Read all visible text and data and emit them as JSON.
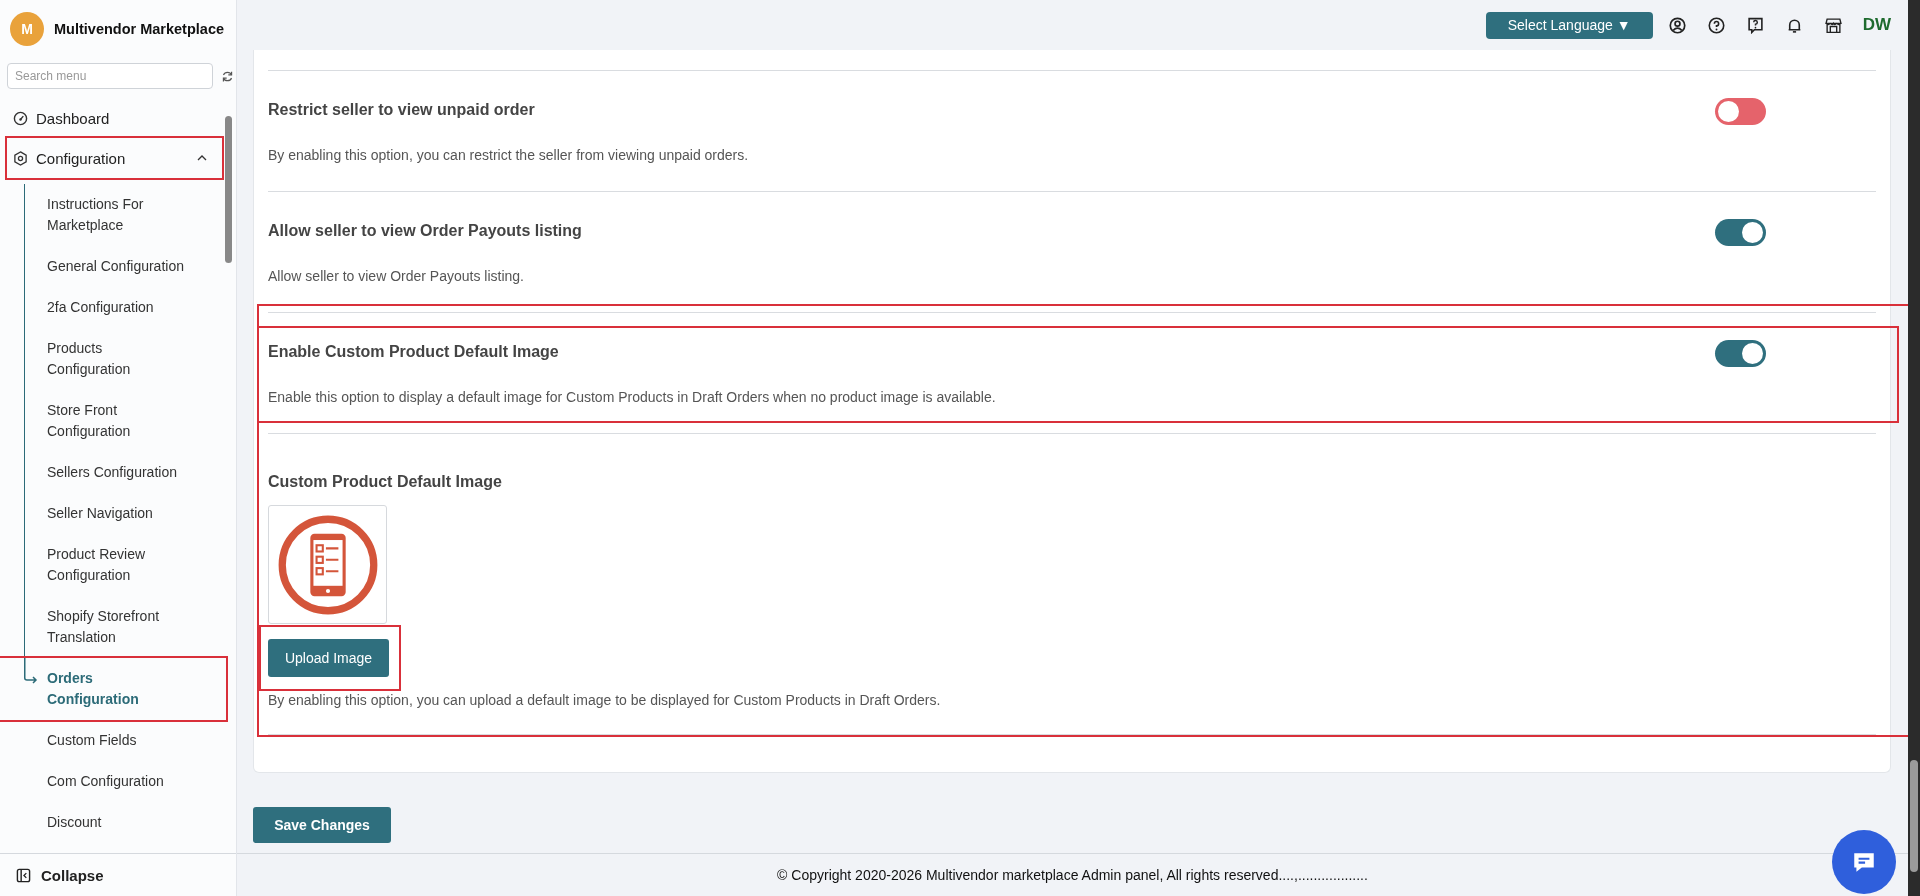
{
  "brand": {
    "initial": "M",
    "name": "Multivendor Marketplace"
  },
  "search": {
    "placeholder": "Search menu"
  },
  "nav": [
    {
      "kind": "item",
      "label": "Dashboard"
    },
    {
      "kind": "group",
      "label": "Configuration",
      "expanded": true,
      "annotated": true,
      "children": [
        {
          "label": "Instructions For Marketplace",
          "selected": false
        },
        {
          "label": "General Configuration",
          "selected": false
        },
        {
          "label": "2fa Configuration",
          "selected": false
        },
        {
          "label": "Products Configuration",
          "selected": false
        },
        {
          "label": "Store Front Configuration",
          "selected": false
        },
        {
          "label": "Sellers Configuration",
          "selected": false
        },
        {
          "label": "Seller Navigation",
          "selected": false
        },
        {
          "label": "Product Review Configuration",
          "selected": false
        },
        {
          "label": "Shopify Storefront Translation",
          "selected": false
        },
        {
          "label": "Orders Configuration",
          "selected": true,
          "annotated": true
        },
        {
          "label": "Custom Fields",
          "selected": false
        },
        {
          "label": "Com Configuration",
          "selected": false
        },
        {
          "label": "Discount",
          "selected": false
        }
      ]
    }
  ],
  "collapse": "Collapse",
  "header": {
    "language_button": "Select Language",
    "language_caret": "▼",
    "user_initials": "DW"
  },
  "setting_groups": [
    {
      "annotated": false,
      "items": [
        {
          "kind": "toggle",
          "title": "Restrict seller to view unpaid order",
          "description": "By enabling this option, you can restrict the seller from viewing unpaid orders.",
          "on": false,
          "annotated": false
        },
        {
          "kind": "toggle",
          "title": "Allow seller to view Order Payouts listing",
          "description": "Allow seller to view Order Payouts listing.",
          "on": true,
          "annotated": false
        }
      ]
    },
    {
      "annotated": true,
      "items": [
        {
          "kind": "toggle",
          "title": "Enable Custom Product Default Image",
          "description": "Enable this option to display a default image for Custom Products in Draft Orders when no product image is available.",
          "on": true,
          "annotated": true
        },
        {
          "kind": "image",
          "title": "Custom Product Default Image",
          "button": "Upload Image",
          "button_annotated": true,
          "description": "By enabling this option, you can upload a default image to be displayed for Custom Products in Draft Orders."
        }
      ]
    }
  ],
  "save_button": "Save Changes",
  "footer": "© Copyright 2020-2026 Multivendor marketplace Admin panel, All rights reserved....,.................."
}
